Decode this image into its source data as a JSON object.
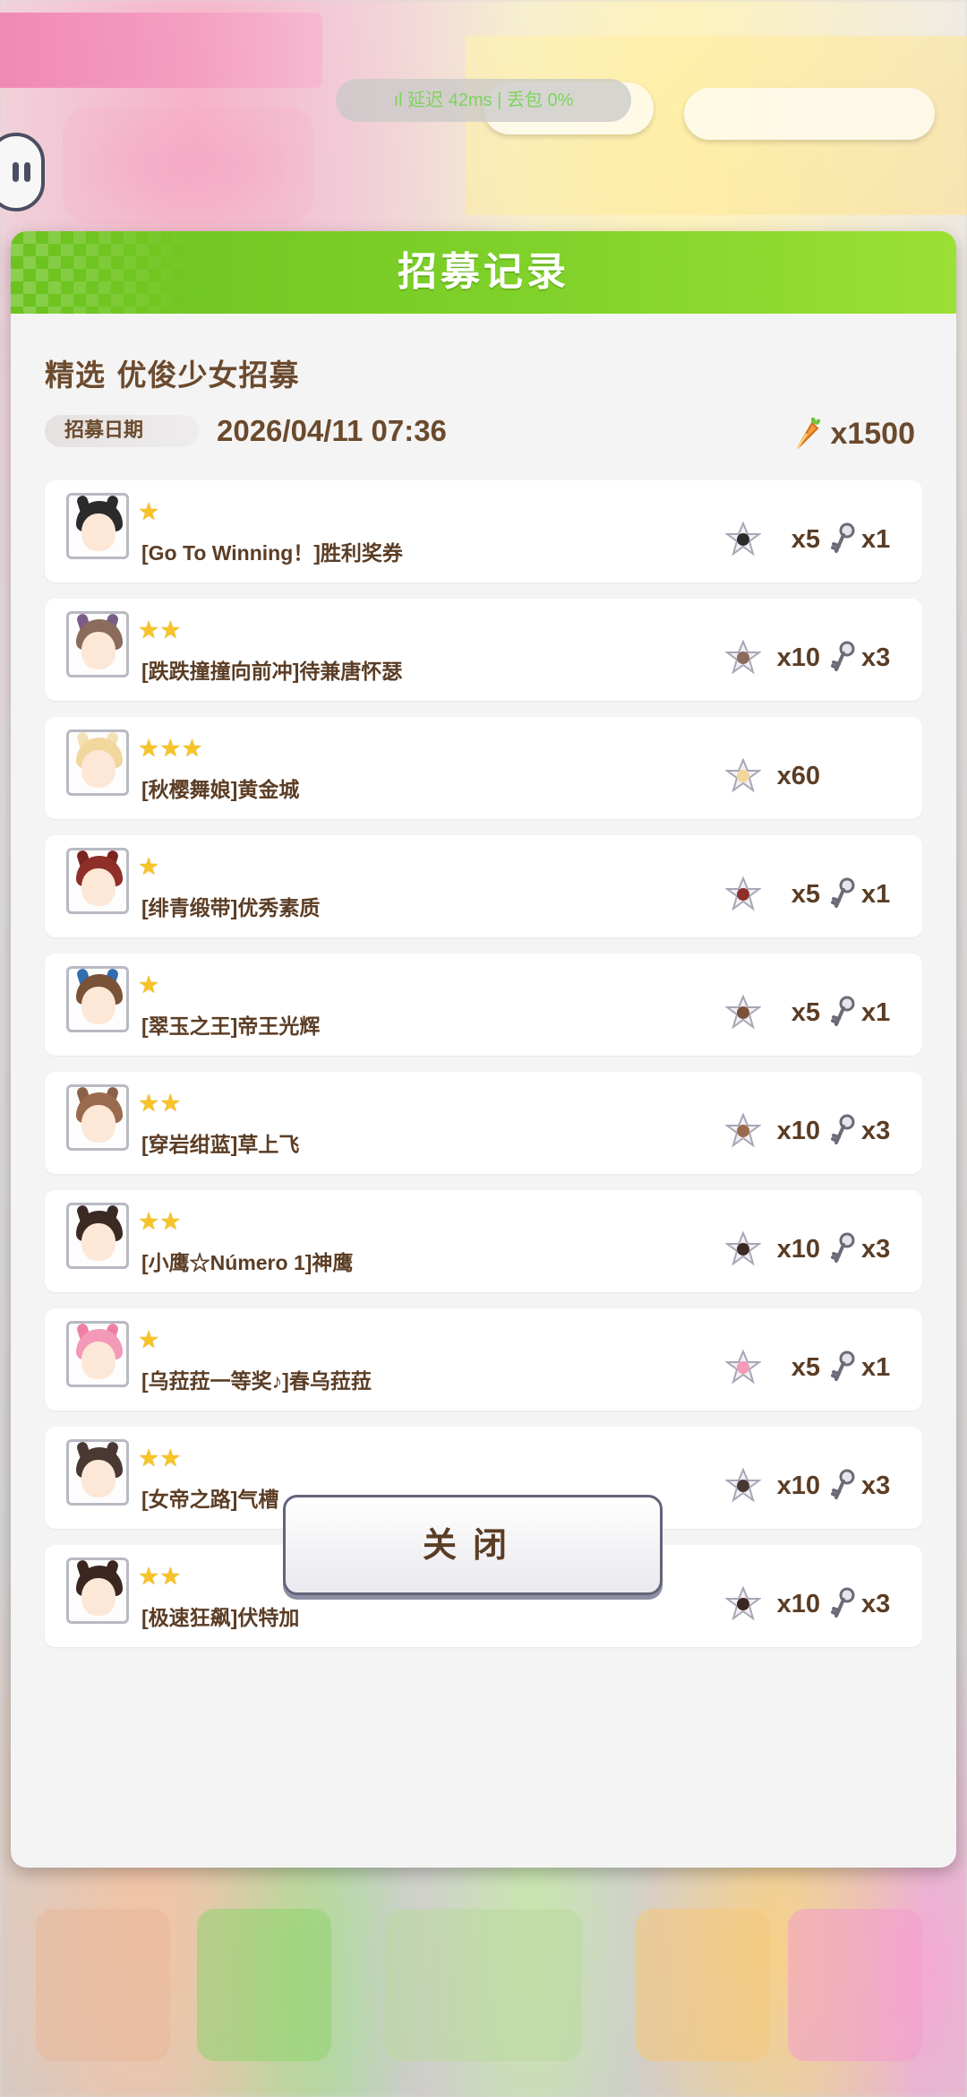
{
  "status_bar": {
    "text": "ıl 延迟 42ms | 丢包 0%"
  },
  "dialog": {
    "title": "招募记录",
    "summary": {
      "banner_name": "精选 优俊少女招募",
      "date_label": "招募日期",
      "date_value": "2026/04/11 07:36",
      "cost_value": "x1500",
      "cost_icon": "carrot-icon"
    },
    "results": [
      {
        "stars": "★",
        "name": "[Go To Winning！]胜利奖券",
        "pieces": "x5",
        "keys": "x1",
        "hair": "#2b2b2b",
        "ear": "#2b2b2b"
      },
      {
        "stars": "★★",
        "name": "[跌跌撞撞向前冲]待兼唐怀瑟",
        "pieces": "x10",
        "keys": "x3",
        "hair": "#8a6b5c",
        "ear": "#7a5d86"
      },
      {
        "stars": "★★★",
        "name": "[秋樱舞娘]黄金城",
        "pieces": "x60",
        "keys": "",
        "hair": "#f1d79b",
        "ear": "#f3e2b6"
      },
      {
        "stars": "★",
        "name": "[绯青缎带]优秀素质",
        "pieces": "x5",
        "keys": "x1",
        "hair": "#8e2f2a",
        "ear": "#7b2420"
      },
      {
        "stars": "★",
        "name": "[翠玉之王]帝王光辉",
        "pieces": "x5",
        "keys": "x1",
        "hair": "#7a5238",
        "ear": "#2f6fb0"
      },
      {
        "stars": "★★",
        "name": "[穿岩绀蓝]草上飞",
        "pieces": "x10",
        "keys": "x3",
        "hair": "#9a6a4e",
        "ear": "#8c6046"
      },
      {
        "stars": "★★",
        "name": "[小鹰☆Número 1]神鹰",
        "pieces": "x10",
        "keys": "x3",
        "hair": "#3b2a24",
        "ear": "#3b2a24"
      },
      {
        "stars": "★",
        "name": "[乌菈菈一等奖♪]春乌菈菈",
        "pieces": "x5",
        "keys": "x1",
        "hair": "#f29ab7",
        "ear": "#ee7fa4"
      },
      {
        "stars": "★★",
        "name": "[女帝之路]气槽",
        "pieces": "x10",
        "keys": "x3",
        "hair": "#4a3832",
        "ear": "#4a3832"
      },
      {
        "stars": "★★",
        "name": "[极速狂飙]伏特加",
        "pieces": "x10",
        "keys": "x3",
        "hair": "#3c2620",
        "ear": "#3c2620"
      }
    ],
    "close_label": "关闭"
  },
  "colors": {
    "header_green": "#7fd22a",
    "text_brown": "#5b3d25",
    "star_yellow": "#f7c326"
  }
}
